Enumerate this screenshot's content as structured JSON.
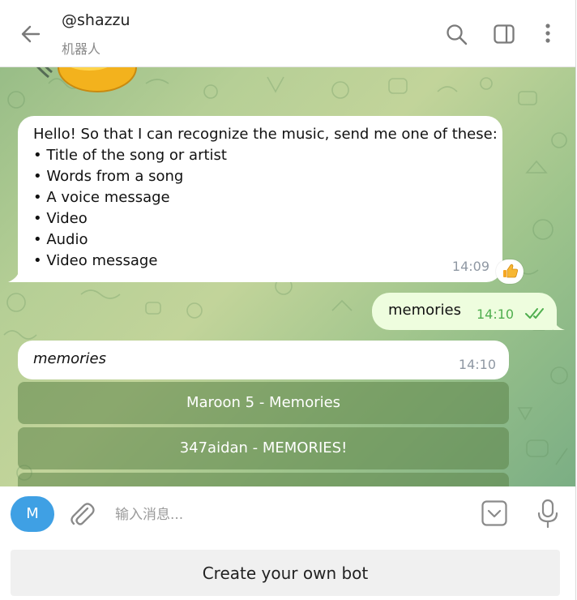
{
  "header": {
    "title": "@shazzu",
    "subtitle": "机器人"
  },
  "messages": {
    "incoming_lines": [
      "Hello! So that I can recognize the music, send me one of these:",
      "• Title of the song or artist",
      "• Words from a song",
      "• A voice message",
      "• Video",
      "• Audio",
      "• Video message"
    ],
    "incoming_time": "14:09",
    "reaction": "👍",
    "outgoing_text": "memories",
    "outgoing_time": "14:10",
    "bot_reply_text": "memories",
    "bot_reply_time": "14:10",
    "inline_buttons": [
      "Maroon 5 - Memories",
      "347aidan - MEMORIES!"
    ]
  },
  "composer": {
    "avatar_letter": "M",
    "placeholder": "输入消息..."
  },
  "bottom_button": "Create your own bot",
  "colors": {
    "accent": "#3fa0e4",
    "read_ticks": "#4fae4e",
    "outgoing_bubble": "#eefdde"
  },
  "icons": [
    "back-arrow-icon",
    "search-icon",
    "sidebar-toggle-icon",
    "more-vertical-icon",
    "paperclip-icon",
    "bot-commands-icon",
    "microphone-icon",
    "double-check-icon"
  ]
}
